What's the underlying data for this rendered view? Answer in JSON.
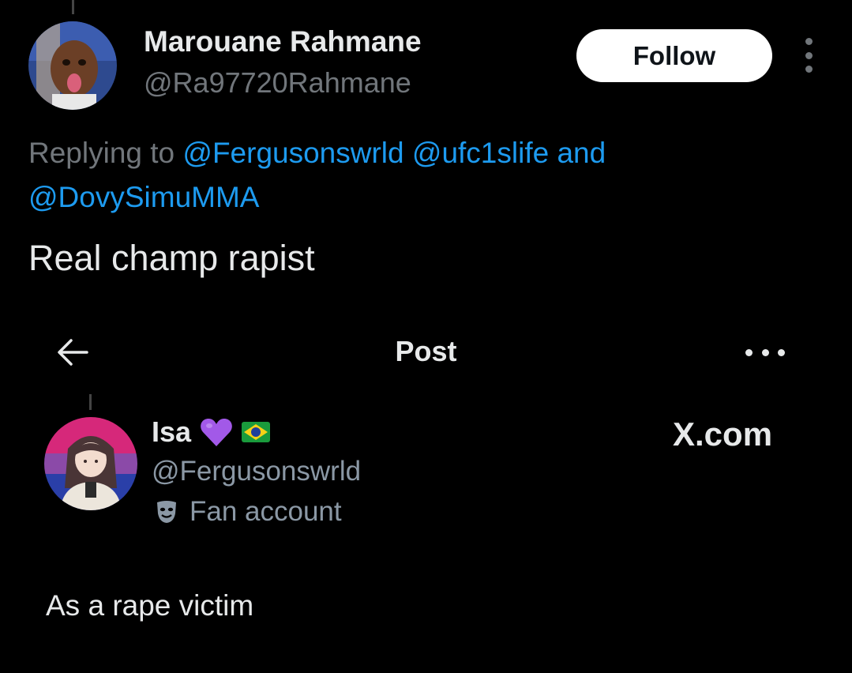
{
  "reply": {
    "display_name": "Marouane Rahmane",
    "handle": "@Ra97720Rahmane",
    "follow_label": "Follow",
    "replying_prefix": "Replying to ",
    "mentions": [
      "@Fergusonswrld",
      "@ufc1slife",
      "@DovySimuMMA"
    ],
    "mentions_join": " and",
    "text": "Real champ rapist"
  },
  "embedded_post": {
    "header_title": "Post",
    "display_name": "Isa",
    "name_emojis": [
      "purple-heart",
      "brazil-flag"
    ],
    "handle": "@Fergusonswrld",
    "bio_icon": "theater-mask-icon",
    "bio": "Fan account",
    "watermark": "X.com",
    "text": "As a rape victim"
  },
  "colors": {
    "background": "#000000",
    "text": "#e7e9ea",
    "muted": "#71767b",
    "link": "#1d9bf0",
    "follow_bg": "#ffffff"
  }
}
